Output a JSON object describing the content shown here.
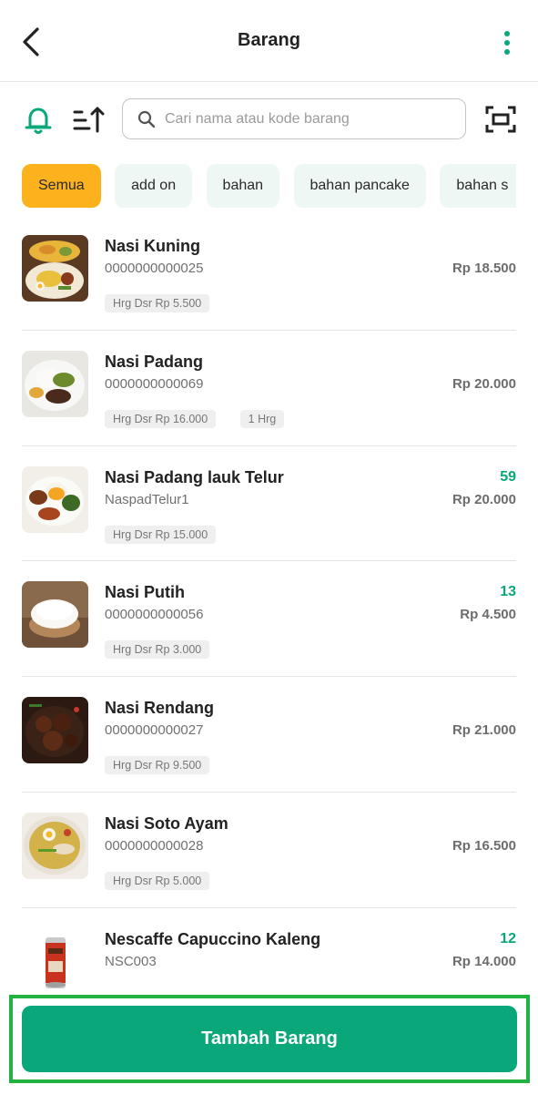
{
  "header": {
    "title": "Barang"
  },
  "search": {
    "placeholder": "Cari nama atau kode barang"
  },
  "categories": [
    "Semua",
    "add on",
    "bahan",
    "bahan pancake",
    "bahan s"
  ],
  "active_category": "Semua",
  "items": [
    {
      "name": "Nasi Kuning",
      "code": "0000000000025",
      "stock": "",
      "price": "Rp 18.500",
      "tags": [
        "Hrg Dsr Rp 5.500"
      ]
    },
    {
      "name": "Nasi Padang",
      "code": "0000000000069",
      "stock": "",
      "price": "Rp 20.000",
      "tags": [
        "Hrg Dsr Rp 16.000",
        "1 Hrg"
      ]
    },
    {
      "name": "Nasi Padang lauk Telur",
      "code": "NaspadTelur1",
      "stock": "59",
      "price": "Rp 20.000",
      "tags": [
        "Hrg Dsr Rp 15.000"
      ]
    },
    {
      "name": "Nasi Putih",
      "code": "0000000000056",
      "stock": "13",
      "price": "Rp 4.500",
      "tags": [
        "Hrg Dsr Rp 3.000"
      ]
    },
    {
      "name": "Nasi Rendang",
      "code": "0000000000027",
      "stock": "",
      "price": "Rp 21.000",
      "tags": [
        "Hrg Dsr Rp 9.500"
      ]
    },
    {
      "name": "Nasi Soto Ayam",
      "code": "0000000000028",
      "stock": "",
      "price": "Rp 16.500",
      "tags": [
        "Hrg Dsr Rp 5.000"
      ]
    },
    {
      "name": "Nescaffe Capuccino Kaleng",
      "code": "NSC003",
      "stock": "12",
      "price": "Rp 14.000",
      "tags": []
    }
  ],
  "footer": {
    "add_button_label": "Tambah Barang"
  },
  "colors": {
    "primary": "#0aa77a",
    "chip_active": "#fbb21c",
    "chip_bg": "#eef7f3",
    "highlight_frame": "#22b23f"
  },
  "icons": [
    "back-arrow-icon",
    "more-vertical-icon",
    "bell-icon",
    "sort-icon",
    "search-icon",
    "scan-icon"
  ]
}
